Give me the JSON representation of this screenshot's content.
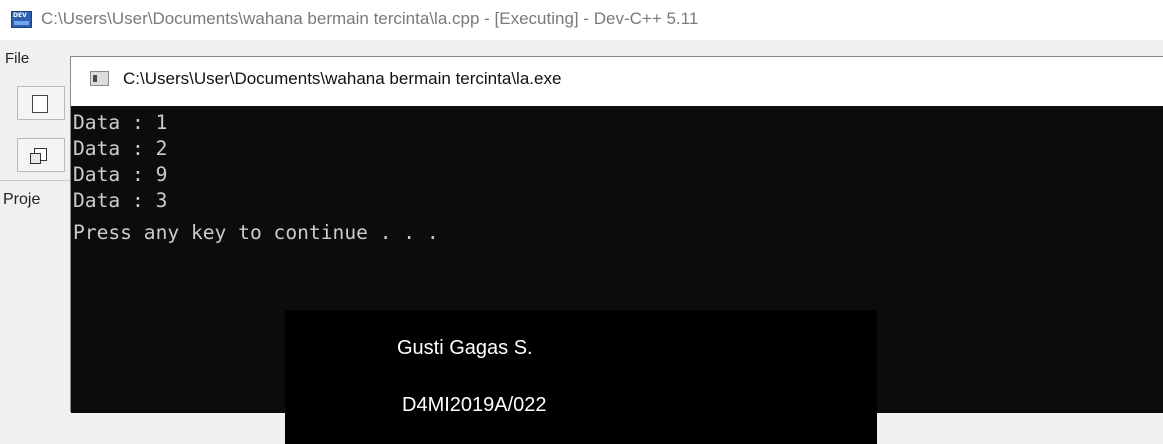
{
  "ide": {
    "title": "C:\\Users\\User\\Documents\\wahana bermain tercinta\\la.cpp - [Executing] - Dev-C++ 5.11",
    "menu_file": "File",
    "panel_label": "Proje"
  },
  "console": {
    "title": "C:\\Users\\User\\Documents\\wahana bermain tercinta\\la.exe",
    "lines": [
      "Data : 1",
      "Data : 2",
      "Data : 9",
      "Data : 3",
      "Press any key to continue . . ."
    ]
  },
  "overlay": {
    "name": "Gusti Gagas S.",
    "id": "D4MI2019A/022"
  },
  "colors": {
    "console_bg": "#0c0c0c",
    "console_text": "#cccccc",
    "overlay_bg": "#000000",
    "overlay_text": "#ffffff"
  },
  "icons": [
    "devcpp-app-icon",
    "console-app-icon",
    "new-file-icon",
    "window-icon"
  ]
}
